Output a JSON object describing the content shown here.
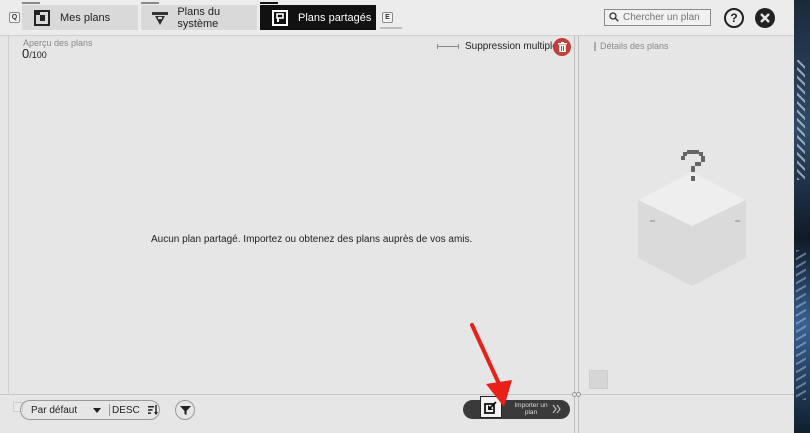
{
  "tabs": [
    {
      "label": "Mes plans",
      "active": false
    },
    {
      "label": "Plans du système",
      "active": false
    },
    {
      "label": "Plans partagés",
      "active": true
    }
  ],
  "key_hints": {
    "left": "Q",
    "right": "E"
  },
  "search": {
    "placeholder": "Chercher un plan"
  },
  "overview": {
    "label": "Aperçu des plans",
    "count": "0",
    "max": "/100"
  },
  "bulk_delete": {
    "label": "Suppression multiple"
  },
  "empty_message": "Aucun plan partagé. Importez ou obtenez des plans auprès de vos amis.",
  "details": {
    "label": "Détails des plans"
  },
  "sort": {
    "value": "Par défaut",
    "direction": "DESC"
  },
  "import": {
    "label": "Importer un plan"
  },
  "colors": {
    "accent_dark": "#111111",
    "danger": "#c0403c",
    "annotation_arrow": "#e8201a"
  },
  "icons": [
    "search-icon",
    "help-icon",
    "close-icon",
    "trash-icon",
    "filter-icon",
    "sort-icon",
    "import-icon",
    "chevron-down-icon",
    "double-chevron-right-icon",
    "unknown-cube-icon"
  ]
}
